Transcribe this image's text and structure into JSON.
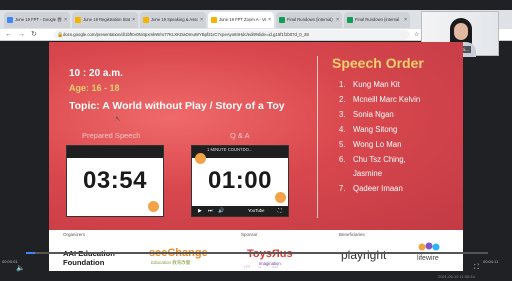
{
  "browser": {
    "tabs": [
      {
        "label": "June 19 FPT - Google 雲端",
        "color": "#4285f4",
        "active": false
      },
      {
        "label": "June 19 Registration Statis",
        "color": "#f4b400",
        "active": false
      },
      {
        "label": "June 19 Speaking & Assoc",
        "color": "#f4b400",
        "active": false
      },
      {
        "label": "June 19 FPT Zoom A - Ver",
        "color": "#f4b400",
        "active": true
      },
      {
        "label": "Final Rundown (internal)",
        "color": "#0f9d58",
        "active": false
      },
      {
        "label": "Final Rundown (internal",
        "color": "#0f9d58",
        "active": false
      }
    ],
    "url": "docs.google.com/presentation/d/1bfEv0Ni4pxmkW/ro77KLXKDaOmuWYBpf21rC7cpeAyo84Hdc/edit#slide=id.g15f1f1b07d_0_28"
  },
  "participant": {
    "name": "Chu Tsz Ching Jasmi..."
  },
  "slide": {
    "time": "10 : 20 a.m.",
    "age": "Age: 16 - 18",
    "topic": "Topic: A World without Play / Story of a Toy",
    "prepared_label": "Prepared Speech",
    "qa_label": "Q & A",
    "timer1": "03:54",
    "timer2": "01:00",
    "timer2_video_title": "1 MINUTE COUNTDO...",
    "youtube_label": "YouTube",
    "order_title": "Speech Order",
    "order": [
      {
        "num": "1.",
        "name": "Kung Man Kit"
      },
      {
        "num": "2.",
        "name": "Mcneill Marc Kelvin"
      },
      {
        "num": "3.",
        "name": "Sonia Ngan"
      },
      {
        "num": "4.",
        "name": "Wang Sitong"
      },
      {
        "num": "5.",
        "name": "Wong Lo Man"
      },
      {
        "num": "6.",
        "name": "Chu Tsz Ching,"
      },
      {
        "num": "7.",
        "name": "Qadeer Imaan"
      }
    ],
    "order_6_cont": "Jasmine"
  },
  "sponsors": {
    "organizers_label": "Organizers",
    "sponsor_label": "Sponsor",
    "beneficiaries_label": "Beneficiaries",
    "aai_line1": "AAI Education",
    "aai_line2": "Foundation",
    "seechange": "seeChange",
    "seechange_sub": "Education 教育改變",
    "toys": "ToysЯus",
    "toys_sub": "Imagination",
    "playright": "playright",
    "lifewire": "lifewire"
  },
  "player": {
    "time_left": "00:00:01",
    "time_right": "00:04:11",
    "progress": 0.02
  },
  "watermark": "2021-06-19 11:05:44",
  "colors": {
    "slide_accent": "#f4d06f",
    "slide_bg": "#d8474d"
  }
}
